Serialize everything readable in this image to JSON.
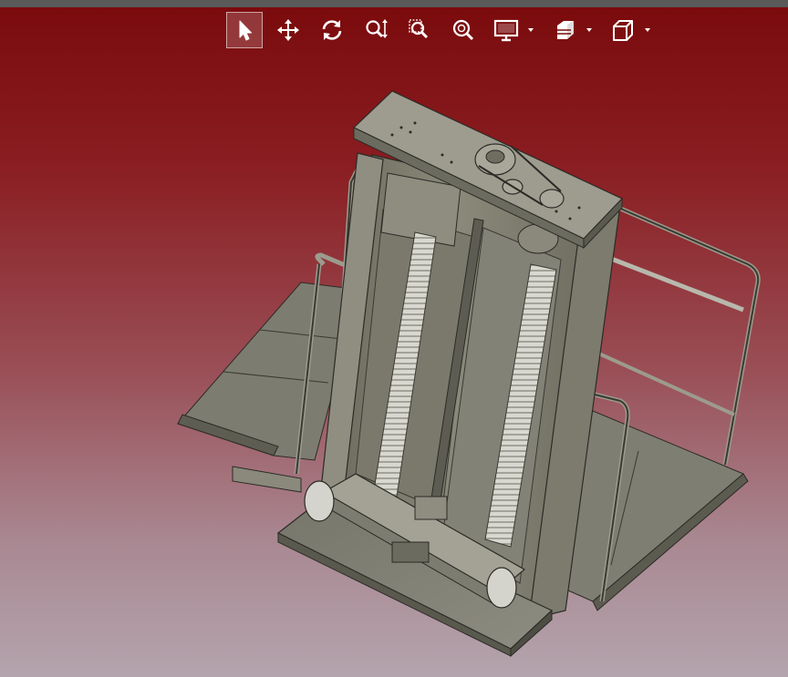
{
  "viewer": {
    "background_top": "#7a0a0c",
    "background_bottom": "#b4a4ad",
    "model_name": ""
  },
  "toolbar": {
    "buttons": [
      {
        "name": "select-tool-button",
        "icon": "arrow-pointer-icon",
        "active": true
      },
      {
        "name": "pan-tool-button",
        "icon": "move-arrows-icon",
        "active": false
      },
      {
        "name": "rotate-tool-button",
        "icon": "rotate-icon",
        "active": false
      },
      {
        "name": "zoom-tool-button",
        "icon": "zoom-vertical-icon",
        "active": false
      },
      {
        "name": "zoom-window-button",
        "icon": "zoom-window-icon",
        "active": false
      },
      {
        "name": "zoom-fit-button",
        "icon": "zoom-fit-icon",
        "active": false
      },
      {
        "name": "display-mode-button",
        "icon": "monitor-icon",
        "dropdown": true
      },
      {
        "name": "section-view-button",
        "icon": "section-cube-icon",
        "dropdown": true
      },
      {
        "name": "standard-views-button",
        "icon": "cube-icon",
        "dropdown": true
      }
    ]
  }
}
